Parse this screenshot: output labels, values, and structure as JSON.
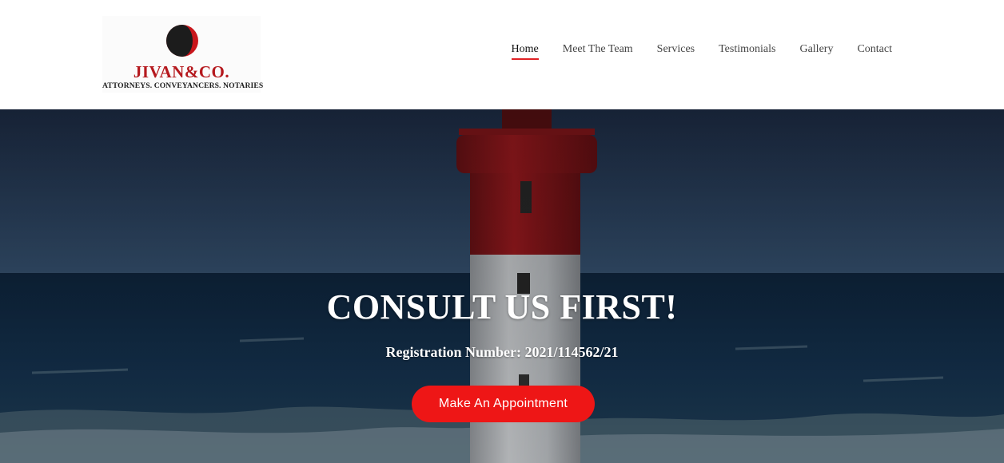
{
  "brand": {
    "name": "JIVAN&CO.",
    "tagline": "ATTORNEYS. CONVEYANCERS. NOTARIES",
    "logo_icon": "split-circle-logo",
    "colors": {
      "red": "#b5191e",
      "dark": "#1e1e1e"
    }
  },
  "nav": {
    "items": [
      {
        "label": "Home",
        "active": true
      },
      {
        "label": "Meet The Team",
        "active": false
      },
      {
        "label": "Services",
        "active": false
      },
      {
        "label": "Testimonials",
        "active": false
      },
      {
        "label": "Gallery",
        "active": false
      },
      {
        "label": "Contact",
        "active": false
      }
    ],
    "active_color": "#e02225"
  },
  "hero": {
    "title": "CONSULT US FIRST!",
    "subtitle": "Registration Number: 2021/114562/21",
    "cta_label": "Make An Appointment",
    "cta_color": "#ee1616",
    "background": "lighthouse-seascape"
  }
}
